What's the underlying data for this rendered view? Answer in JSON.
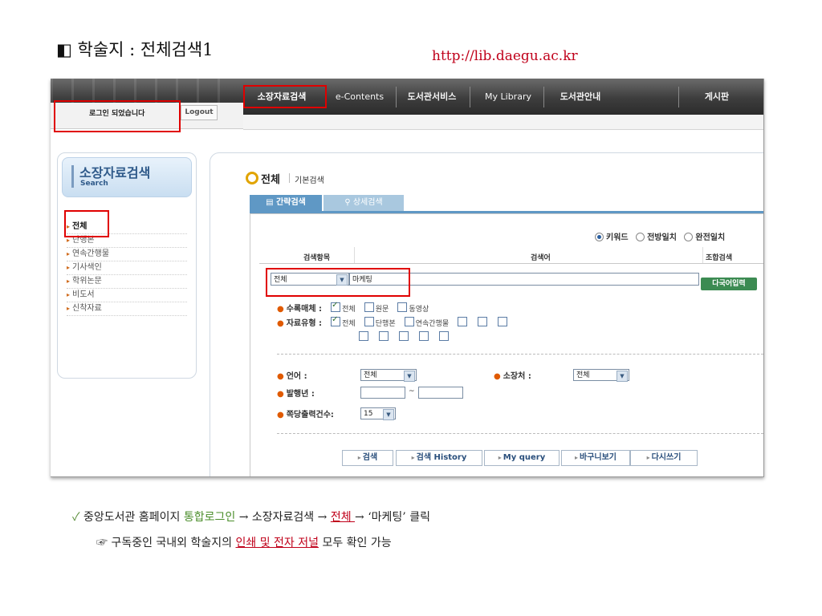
{
  "slide": {
    "title": "◧ 학술지 : 전체검색1",
    "url": "http://lib.daegu.ac.kr"
  },
  "colors": {
    "highlight": "#e00000",
    "accent_red": "#c0001a",
    "accent_green": "#4a8d2a",
    "tab_blue": "#5f98c5",
    "button_green": "#3c8b52"
  },
  "header": {
    "login_message": "로그인 되었습니다",
    "logout_label": "Logout",
    "menu": [
      "소장자료검색",
      "e-Contents",
      "도서관서비스",
      "My Library",
      "도서관안내",
      "게시판"
    ]
  },
  "sidebar": {
    "title": "소장자료검색",
    "subtitle": "Search",
    "items": [
      "전체",
      "단행본",
      "연속간행물",
      "기사색인",
      "학위논문",
      "비도서",
      "신착자료"
    ]
  },
  "main": {
    "heading": "전체",
    "subheading": "기본검색",
    "tabs": [
      "간략검색",
      "상세검색"
    ],
    "match_options": [
      "키워드",
      "전방일치",
      "완전일치"
    ],
    "selected_match": "키워드",
    "columns": [
      "검색항목",
      "검색어",
      "조합검색"
    ],
    "field_select": "전체",
    "keyword_value": "마케팅",
    "multi_lang_button": "다국어입력",
    "format_label": "수록매체 :",
    "format_options": [
      "전체",
      "원문",
      "동영상"
    ],
    "type_label": "자료유형 :",
    "type_options": [
      "전체",
      "단행본",
      "연속간행물"
    ],
    "language_label": "언어 :",
    "language_value": "전체",
    "location_label": "소장처 :",
    "location_value": "전체",
    "year_label": "발행년 :",
    "year_separator": "~",
    "per_page_label": "쪽당출력건수:",
    "per_page_value": "15",
    "action_buttons": [
      "검색",
      "검색 History",
      "My query",
      "바구니보기",
      "다시쓰기"
    ]
  },
  "notes": {
    "line1_a": "중앙도서관 홈페이지",
    "line1_b": "통합로그인",
    "line1_c": "→ 소장자료검색 →",
    "line1_d": "전체 ",
    "line1_e": "→ ‘마케팅’ 클릭",
    "line2_a": "구독중인 국내외 학술지의",
    "line2_b": "인쇄 및 전자 저널",
    "line2_c": "모두 확인 가능"
  }
}
